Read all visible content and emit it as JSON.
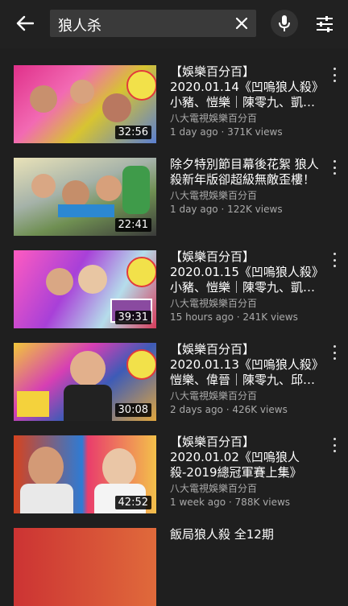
{
  "header": {
    "query": "狼人杀"
  },
  "videos": [
    {
      "title": "【娛樂百分百】2020.01.14《凹嗚狼人殺》小豬、愷樂｜陳零九、凱…",
      "channel": "八大電視娛樂百分百",
      "stats": "1 day ago · 371K views",
      "duration": "32:56"
    },
    {
      "title": "除夕特別節目幕後花絮 狼人殺新年版卻超級無敵歪樓！",
      "channel": "八大電視娛樂百分百",
      "stats": "1 day ago · 122K views",
      "duration": "22:41"
    },
    {
      "title": "【娛樂百分百】2020.01.15《凹嗚狼人殺》小豬、愷樂｜陳零九、凱…",
      "channel": "八大電視娛樂百分百",
      "stats": "15 hours ago · 241K views",
      "duration": "39:31"
    },
    {
      "title": "【娛樂百分百】2020.01.13《凹嗚狼人殺》愷樂、偉晉｜陳零九、邱…",
      "channel": "八大電視娛樂百分百",
      "stats": "2 days ago · 426K views",
      "duration": "30:08"
    },
    {
      "title": "【娛樂百分百】2020.01.02《凹嗚狼人殺-2019總冠軍賽上集》",
      "channel": "八大電視娛樂百分百",
      "stats": "1 week ago · 788K views",
      "duration": "42:52"
    },
    {
      "title": "飯局狼人殺 全12期",
      "channel": "",
      "stats": "",
      "duration": ""
    }
  ]
}
